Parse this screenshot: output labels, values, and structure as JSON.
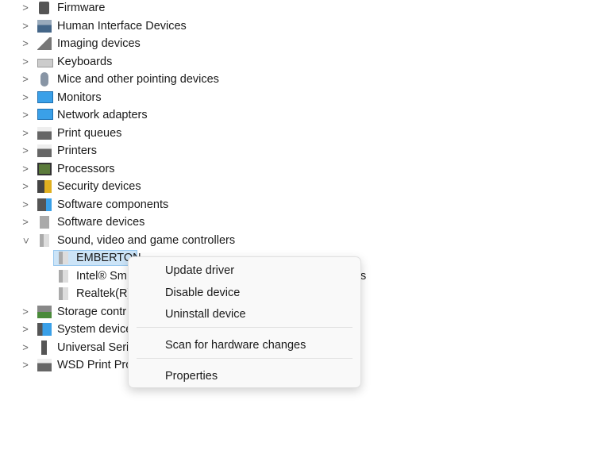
{
  "tree": {
    "categories_top": [
      {
        "label": "Firmware",
        "icon": "firmware-icon"
      },
      {
        "label": "Human Interface Devices",
        "icon": "hid-icon"
      },
      {
        "label": "Imaging devices",
        "icon": "camera-icon"
      },
      {
        "label": "Keyboards",
        "icon": "keyboard-icon"
      },
      {
        "label": "Mice and other pointing devices",
        "icon": "mouse-icon"
      },
      {
        "label": "Monitors",
        "icon": "monitor-icon"
      },
      {
        "label": "Network adapters",
        "icon": "network-icon"
      },
      {
        "label": "Print queues",
        "icon": "printer-icon"
      },
      {
        "label": "Printers",
        "icon": "printer-icon"
      },
      {
        "label": "Processors",
        "icon": "processor-icon"
      },
      {
        "label": "Security devices",
        "icon": "security-icon"
      },
      {
        "label": "Software components",
        "icon": "software-component-icon"
      },
      {
        "label": "Software devices",
        "icon": "software-device-icon"
      }
    ],
    "expanded": {
      "label": "Sound, video and game controllers",
      "icon": "speaker-icon"
    },
    "children": [
      {
        "label": "EMBERTON",
        "selected": true
      },
      {
        "label": "Intel® Sm",
        "tail": "s"
      },
      {
        "label": "Realtek(R)"
      }
    ],
    "categories_bottom": [
      {
        "label": "Storage contr",
        "icon": "storage-icon"
      },
      {
        "label": "System device",
        "icon": "system-icon"
      },
      {
        "label": "Universal Seri",
        "icon": "usb-icon"
      },
      {
        "label": "WSD Print Pro",
        "icon": "printer-icon"
      }
    ]
  },
  "context_menu": {
    "items": [
      "Update driver",
      "Disable device",
      "Uninstall device",
      "Scan for hardware changes",
      "Properties"
    ]
  },
  "colors": {
    "selection": "#cce4f7",
    "selection_border": "#99c9ef",
    "menu_bg": "#f9f9f9"
  }
}
